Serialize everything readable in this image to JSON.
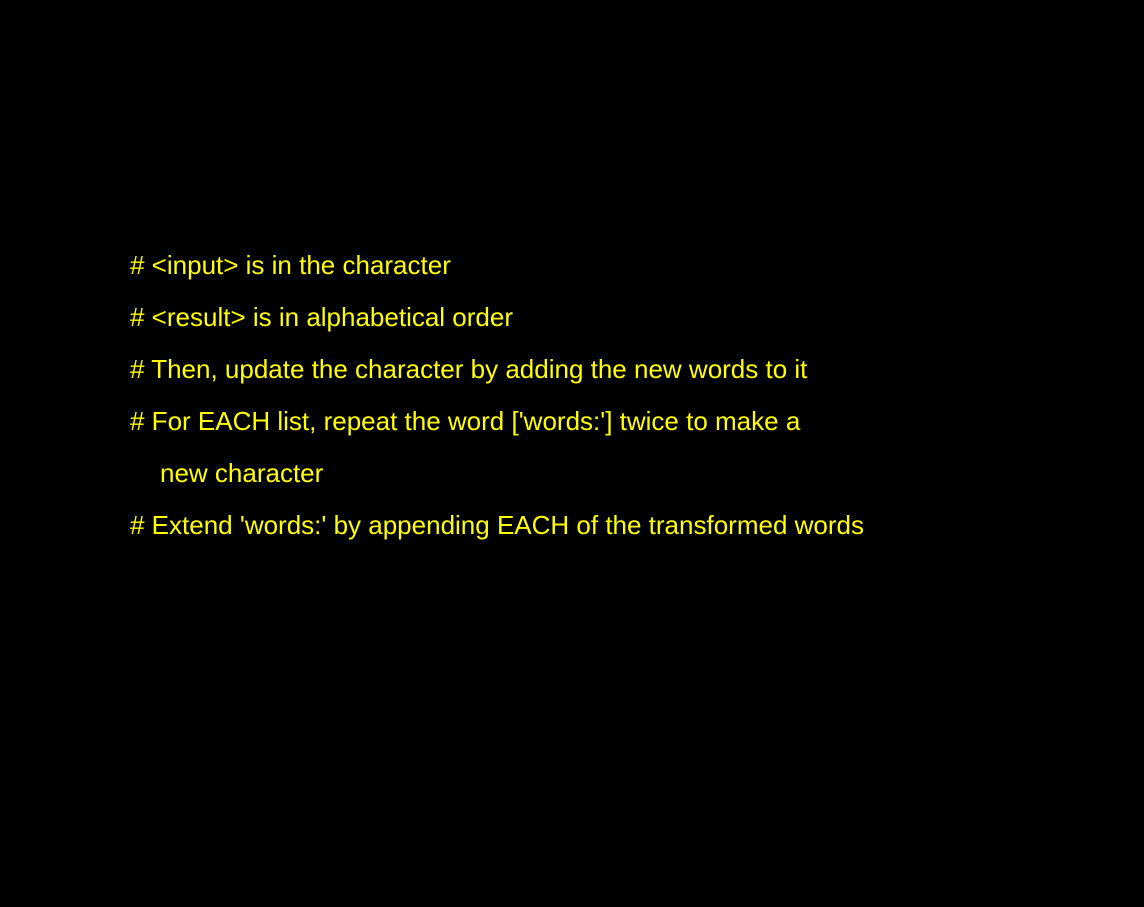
{
  "colors": {
    "background": "#000000",
    "text": "#FFFF00"
  },
  "lines": [
    "# <input> is in the character",
    "# <result> is in alphabetical order",
    "# Then, update the character by adding the new words to it",
    "# For EACH list, repeat the word ['words:'] twice to make a",
    "new character",
    "# Extend 'words:' by appending EACH of the transformed words"
  ]
}
